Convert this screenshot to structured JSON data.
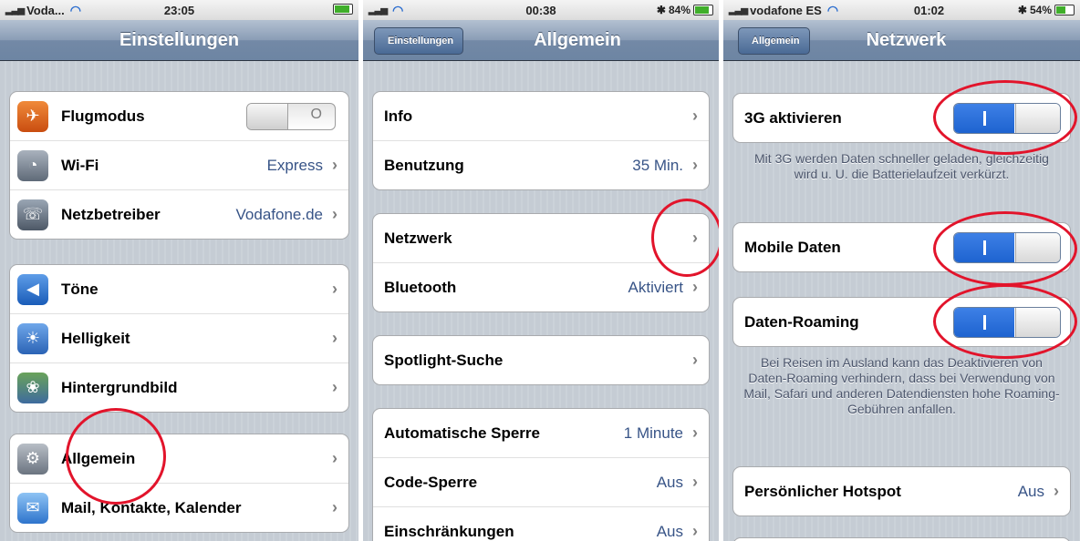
{
  "screens": [
    {
      "status": {
        "carrier": "Voda...",
        "time": "23:05",
        "battery_pct": ""
      },
      "title": "Einstellungen",
      "groups": [
        [
          {
            "icon": "airplane-icon",
            "label": "Flugmodus",
            "control": "toggle-off",
            "toggle_text": "O"
          },
          {
            "icon": "wifi-icon",
            "label": "Wi-Fi",
            "value": "Express"
          },
          {
            "icon": "phone-icon",
            "label": "Netzbetreiber",
            "value": "Vodafone.de"
          }
        ],
        [
          {
            "icon": "speaker-icon",
            "label": "Töne"
          },
          {
            "icon": "sun-icon",
            "label": "Helligkeit"
          },
          {
            "icon": "wallpaper-icon",
            "label": "Hintergrundbild"
          }
        ],
        [
          {
            "icon": "gear-icon",
            "label": "Allgemein"
          },
          {
            "icon": "mail-icon",
            "label": "Mail, Kontakte, Kalender"
          }
        ]
      ]
    },
    {
      "status": {
        "carrier": "",
        "time": "00:38",
        "battery_pct": "84%"
      },
      "back": "Einstellungen",
      "title": "Allgemein",
      "groups": [
        [
          {
            "label": "Info"
          },
          {
            "label": "Benutzung",
            "value": "35 Min."
          }
        ],
        [
          {
            "label": "Netzwerk"
          },
          {
            "label": "Bluetooth",
            "value": "Aktiviert"
          }
        ],
        [
          {
            "label": "Spotlight-Suche"
          }
        ],
        [
          {
            "label": "Automatische Sperre",
            "value": "1 Minute"
          },
          {
            "label": "Code-Sperre",
            "value": "Aus"
          },
          {
            "label": "Einschränkungen",
            "value": "Aus"
          }
        ]
      ]
    },
    {
      "status": {
        "carrier": "vodafone ES",
        "time": "01:02",
        "battery_pct": "54%"
      },
      "back": "Allgemein",
      "title": "Netzwerk",
      "rows": {
        "g3": {
          "label": "3G aktivieren",
          "state": "on"
        },
        "g3_note": "Mit 3G werden Daten schneller geladen, gleichzeitig wird u. U. die Batterielaufzeit verkürzt.",
        "mobile": {
          "label": "Mobile Daten",
          "state": "on"
        },
        "roaming": {
          "label": "Daten-Roaming",
          "state": "on"
        },
        "roaming_note": "Bei Reisen im Ausland kann das Deaktivieren von Daten-Roaming verhindern, dass bei Verwendung von Mail, Safari und anderen Datendiensten hohe Roaming-Gebühren anfallen.",
        "hotspot": {
          "label": "Persönlicher Hotspot",
          "value": "Aus"
        }
      }
    }
  ],
  "chevron": "›",
  "colors": {
    "highlight_circle": "#e2142b",
    "value_text": "#385487",
    "toggle_on": "#1e63d0"
  }
}
